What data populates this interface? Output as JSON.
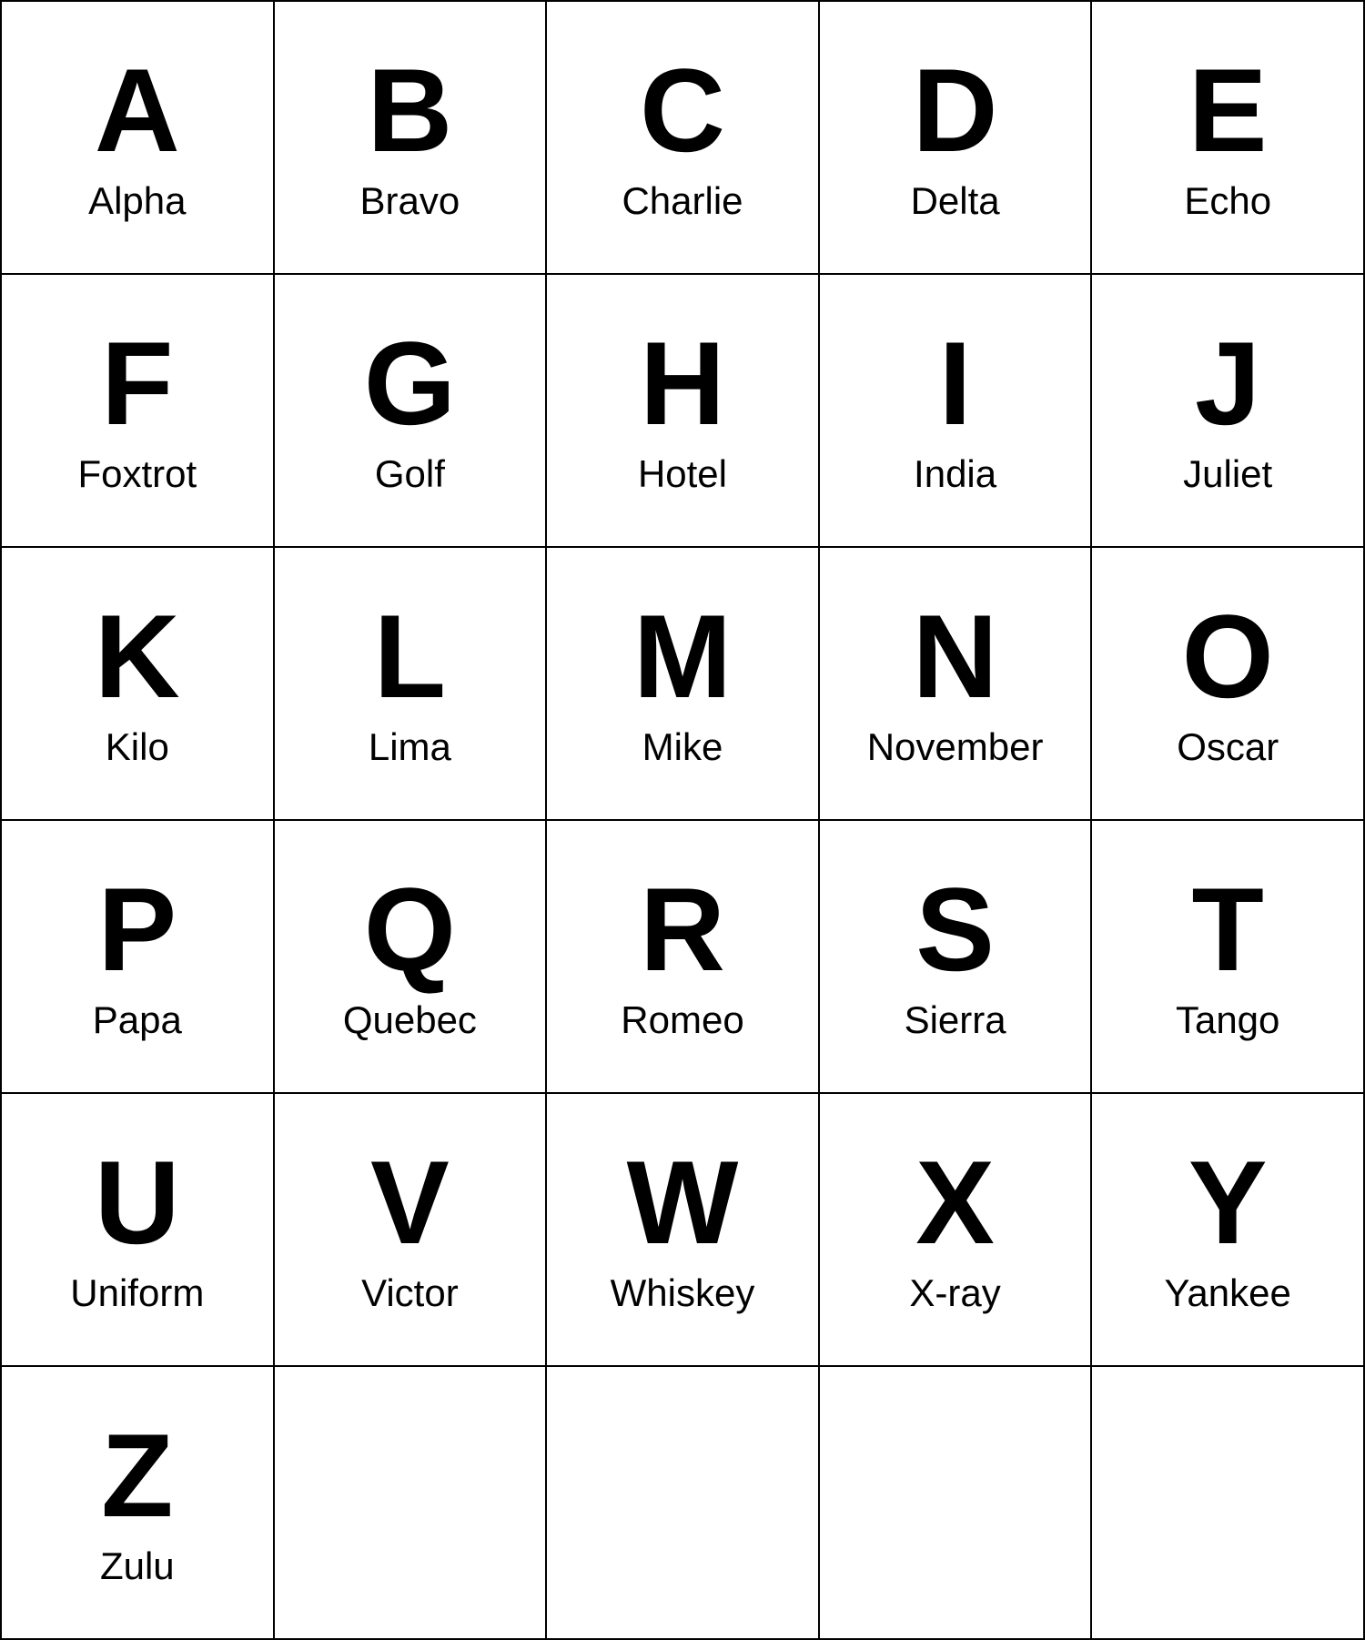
{
  "alphabet": [
    {
      "letter": "A",
      "name": "Alpha"
    },
    {
      "letter": "B",
      "name": "Bravo"
    },
    {
      "letter": "C",
      "name": "Charlie"
    },
    {
      "letter": "D",
      "name": "Delta"
    },
    {
      "letter": "E",
      "name": "Echo"
    },
    {
      "letter": "F",
      "name": "Foxtrot"
    },
    {
      "letter": "G",
      "name": "Golf"
    },
    {
      "letter": "H",
      "name": "Hotel"
    },
    {
      "letter": "I",
      "name": "India"
    },
    {
      "letter": "J",
      "name": "Juliet"
    },
    {
      "letter": "K",
      "name": "Kilo"
    },
    {
      "letter": "L",
      "name": "Lima"
    },
    {
      "letter": "M",
      "name": "Mike"
    },
    {
      "letter": "N",
      "name": "November"
    },
    {
      "letter": "O",
      "name": "Oscar"
    },
    {
      "letter": "P",
      "name": "Papa"
    },
    {
      "letter": "Q",
      "name": "Quebec"
    },
    {
      "letter": "R",
      "name": "Romeo"
    },
    {
      "letter": "S",
      "name": "Sierra"
    },
    {
      "letter": "T",
      "name": "Tango"
    },
    {
      "letter": "U",
      "name": "Uniform"
    },
    {
      "letter": "V",
      "name": "Victor"
    },
    {
      "letter": "W",
      "name": "Whiskey"
    },
    {
      "letter": "X",
      "name": "X-ray"
    },
    {
      "letter": "Y",
      "name": "Yankee"
    },
    {
      "letter": "Z",
      "name": "Zulu"
    }
  ]
}
